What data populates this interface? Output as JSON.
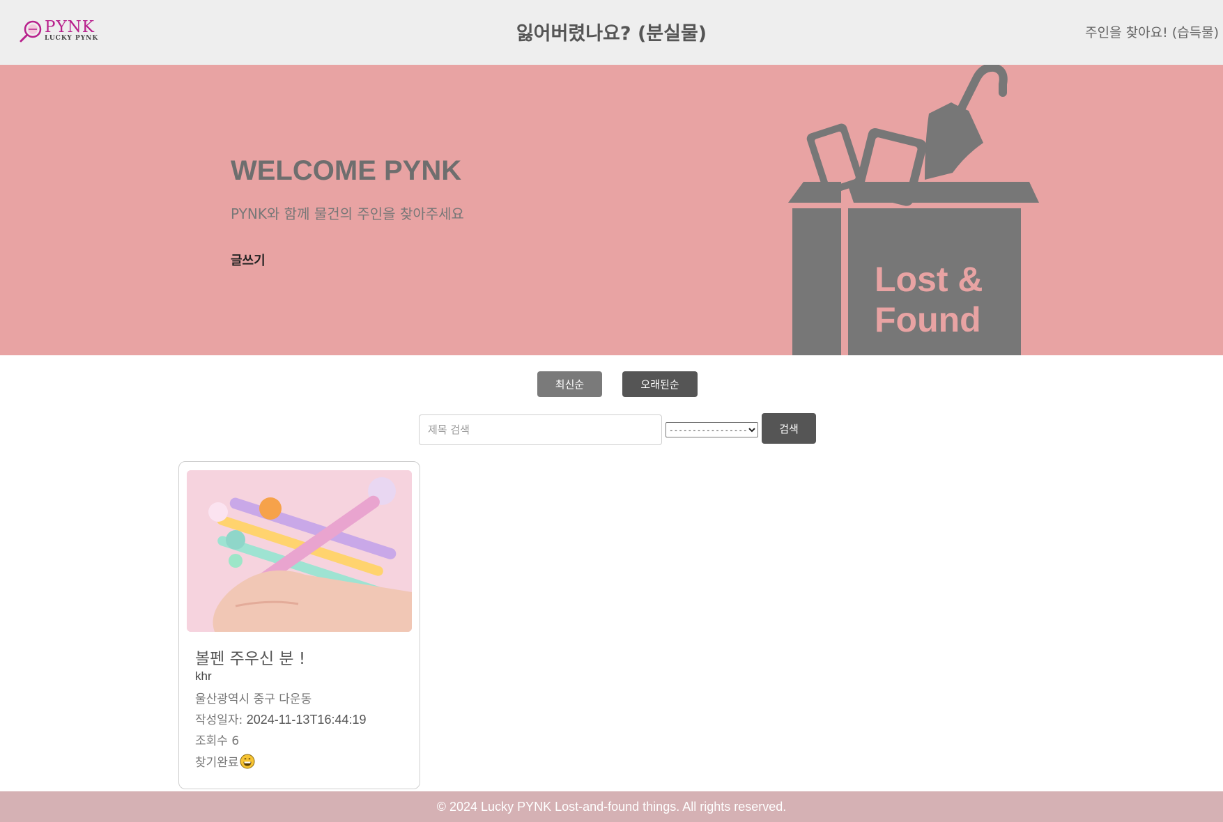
{
  "header": {
    "logo_text": "PYNK",
    "logo_subtext": "LUCKY PYNK",
    "nav_lost": "잃어버렸나요? (분실물)",
    "nav_found": "주인을 찾아요! (습득물)"
  },
  "hero": {
    "title": "WELCOME PYNK",
    "subtitle": "PYNK와 함께 물건의 주인을 찾아주세요",
    "write_link": "글쓰기",
    "art_text_line1": "Lost &",
    "art_text_line2": "Found"
  },
  "sort": {
    "newest_label": "최신순",
    "oldest_label": "오래된순"
  },
  "search": {
    "placeholder": "제목 검색",
    "value": "",
    "select_selected": "--------------------",
    "button_label": "검색"
  },
  "posts": [
    {
      "title": "볼펜 주우신 분 !",
      "author": "khr",
      "location": "울산광역시 중구 다운동",
      "date_label": "작성일자:",
      "date_value": "2024-11-13T16:44:19",
      "views_label": "조회수",
      "views_value": "6",
      "status": "찾기완료",
      "status_icon": "grinning-face-icon"
    }
  ],
  "footer": {
    "text": "© 2024 Lucky PYNK Lost-and-found things. All rights reserved."
  },
  "colors": {
    "header_bg": "#eeeeee",
    "hero_bg": "#e8a3a3",
    "art_gray": "#777777",
    "logo_magenta": "#b8208c",
    "button_dark": "#555555",
    "button_mid": "#7a7a7a",
    "footer_bg": "#d5b1b4"
  }
}
